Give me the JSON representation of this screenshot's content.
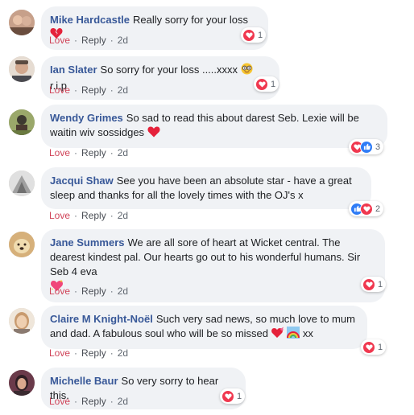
{
  "comments": [
    {
      "author": "Mike Hardcastle",
      "text": "Really sorry for your loss",
      "emoji": "broken-heart",
      "reactions": [
        "love"
      ],
      "reaction_count": "1",
      "love": "Love",
      "reply": "Reply",
      "time": "2d",
      "avatar_colors": [
        "#b48f7a",
        "#7a5a4a"
      ]
    },
    {
      "author": "Ian Slater",
      "text": "So sorry for your loss .....xxxx",
      "emoji_after": "r.i.p",
      "emoji": "nerd-face",
      "reactions": [
        "love"
      ],
      "reaction_count": "1",
      "love": "Love",
      "reply": "Reply",
      "time": "2d",
      "avatar_colors": [
        "#d9c7b7",
        "#8a6e5e"
      ]
    },
    {
      "author": "Wendy Grimes",
      "text": "So sad to read this about darest Seb. Lexie will be waitin wiv sossidges",
      "emoji": "red-heart",
      "reactions": [
        "love",
        "like"
      ],
      "reaction_count": "3",
      "love": "Love",
      "reply": "Reply",
      "time": "2d",
      "avatar_colors": [
        "#8fa060",
        "#3d3a30"
      ]
    },
    {
      "author": "Jacqui Shaw",
      "text": "See you have been an absolute star - have a great sleep and thanks for all the lovely times with the OJ's x",
      "reactions": [
        "like",
        "love"
      ],
      "reaction_count": "2",
      "love": "Love",
      "reply": "Reply",
      "time": "2d",
      "avatar_colors": [
        "#e2e2e2",
        "#9a9a9a"
      ]
    },
    {
      "author": "Jane Summers",
      "text": "We are all sore of heart at Wicket central. The dearest kindest pal. Our hearts go out to his wonderful humans. Sir Seb 4 eva",
      "emoji": "sparkling-heart",
      "reactions": [
        "love"
      ],
      "reaction_count": "1",
      "love": "Love",
      "reply": "Reply",
      "time": "2d",
      "avatar_colors": [
        "#d7b27d",
        "#8a6a3e"
      ]
    },
    {
      "author": "Claire M Knight-Noël",
      "text": "Such very sad news, so much love to mum and dad. A fabulous soul who will be so missed",
      "emoji": "heart-with-ribbon",
      "emoji2": "rainbow",
      "emoji_after": "xx",
      "reactions": [
        "love"
      ],
      "reaction_count": "1",
      "love": "Love",
      "reply": "Reply",
      "time": "2d",
      "avatar_colors": [
        "#e6d2b8",
        "#b08a66"
      ]
    },
    {
      "author": "Michelle Baur",
      "text": "So very sorry to hear this.",
      "reactions": [
        "love"
      ],
      "reaction_count": "1",
      "love": "Love",
      "reply": "Reply",
      "time": "2d",
      "avatar_colors": [
        "#7a4a5a",
        "#3a2a30"
      ]
    }
  ],
  "colors": {
    "author": "#385898",
    "love_action": "#d04358",
    "bubble": "#f0f2f5",
    "love_reaction": "#f0384f",
    "like_reaction": "#2f7cf6"
  }
}
